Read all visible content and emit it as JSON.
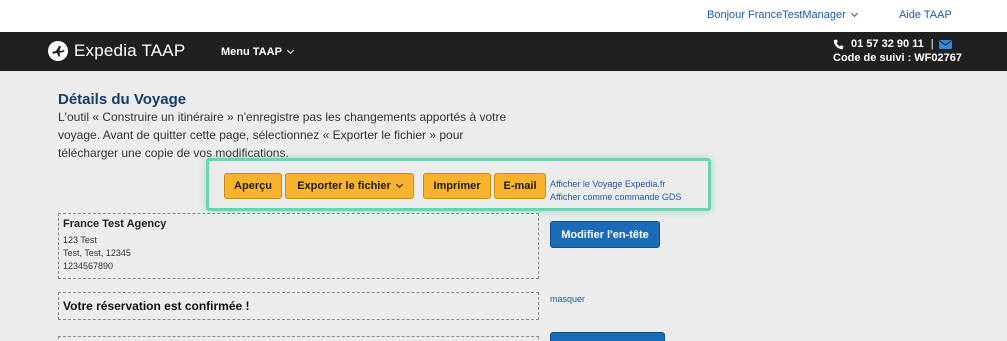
{
  "header": {
    "greeting": "Bonjour FranceTestManager",
    "help": "Aide TAAP"
  },
  "nav": {
    "logo_text": "Expedia TAAP",
    "menu_label": "Menu TAAP",
    "phone": "01 57 32 90 11",
    "separator": "|",
    "tracking": "Code de suivi : WF02767"
  },
  "page": {
    "title": "Détails du Voyage",
    "description": "L'outil « Construire un itinéraire » n'enregistre pas les changements apportés à votre voyage. Avant de quitter cette page, sélectionnez « Exporter le fichier » pour télécharger une copie de vos modifications."
  },
  "toolbar": {
    "preview": "Aperçu",
    "export": "Exporter le fichier",
    "print": "Imprimer",
    "email": "E-mail",
    "view_trip": "Afficher le Voyage Expedia.fr",
    "view_gds": "Afficher comme commande GDS"
  },
  "agency": {
    "name": "France Test Agency",
    "line1": "123 Test",
    "line2": "Test, Test, 12345",
    "phone": "1234567890",
    "edit_header": "Modifier l'en-tête"
  },
  "confirmation": {
    "text": "Votre réservation est confirmée !",
    "hide": "masquer"
  },
  "colors": {
    "nav_bg": "#202020",
    "accent_yellow": "#f7b42c",
    "accent_blue": "#1a6bb8",
    "highlight": "#6ad3b0",
    "link": "#1e5aa8"
  }
}
